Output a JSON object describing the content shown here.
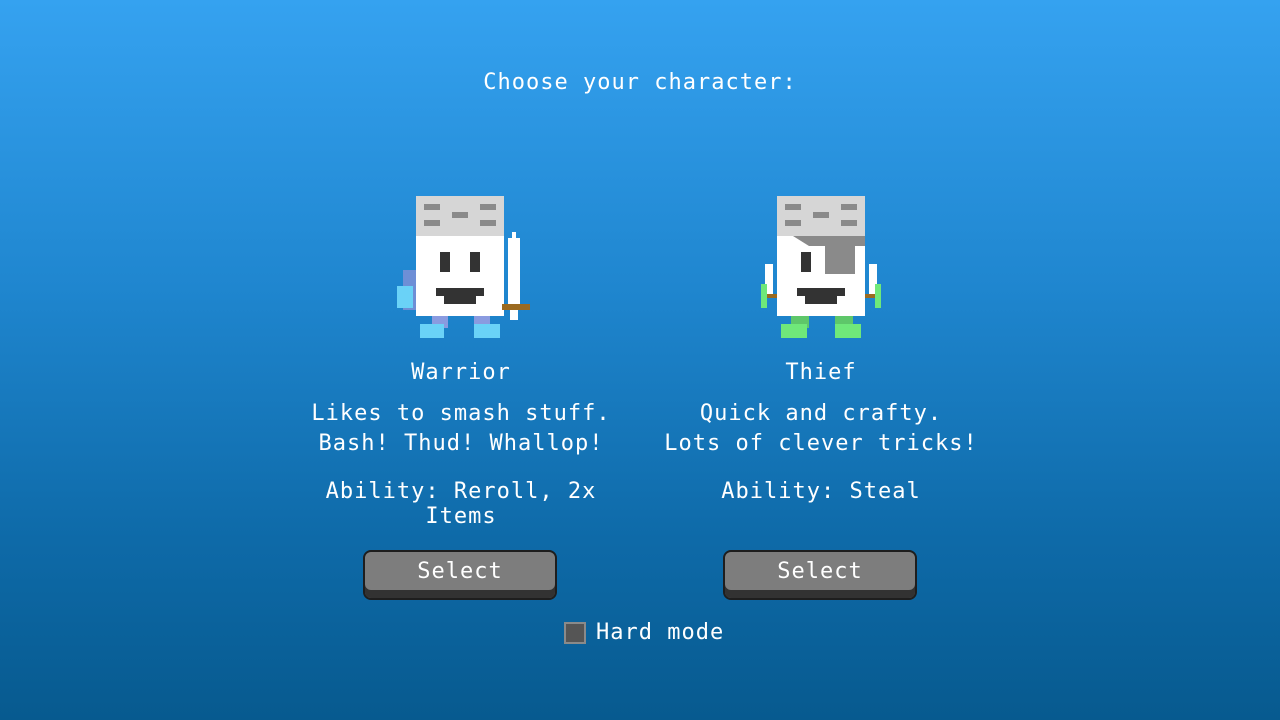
{
  "screen": {
    "title": "Choose your character:"
  },
  "characters": [
    {
      "id": "warrior",
      "name": "Warrior",
      "description": "Likes to smash stuff.\nBash! Thud! Whallop!",
      "ability": "Ability: Reroll, 2x Items",
      "select_label": "Select",
      "sprite": "warrior-sprite",
      "accent_color": "#6ad2f7"
    },
    {
      "id": "thief",
      "name": "Thief",
      "description": "Quick and crafty.\nLots of clever tricks!",
      "ability": "Ability: Steal",
      "select_label": "Select",
      "sprite": "thief-sprite",
      "accent_color": "#6fe87a"
    }
  ],
  "options": {
    "hard_mode_label": "Hard mode",
    "hard_mode_checked": false
  },
  "colors": {
    "background_top": "#35a2f0",
    "background_bottom": "#075a8f",
    "button_face": "#7d7d7d",
    "button_shadow": "#323232"
  }
}
